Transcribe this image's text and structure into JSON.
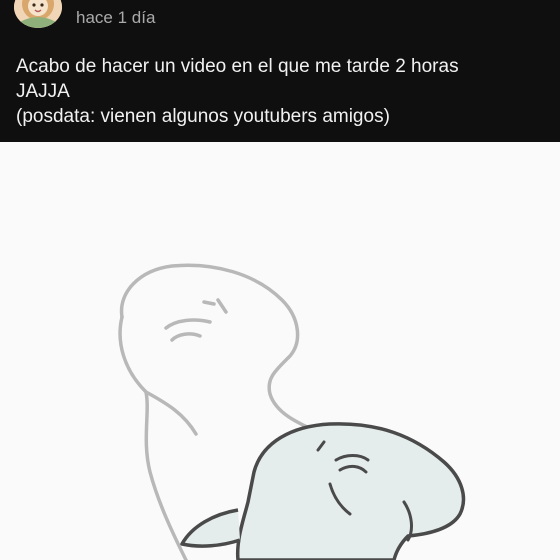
{
  "post": {
    "time_ago": "hace 1 día",
    "text_lines": [
      "Acabo de hacer un video en el que me tarde 2 horas",
      "JAJJA",
      "(posdata: vienen algunos youtubers amigos)"
    ]
  },
  "icons": {
    "avatar": "avatar-cartoon-icon"
  },
  "colors": {
    "background": "#0f0f0f",
    "text_primary": "#f1f1f1",
    "text_secondary": "#aaaaaa",
    "image_background": "#fafafa"
  }
}
